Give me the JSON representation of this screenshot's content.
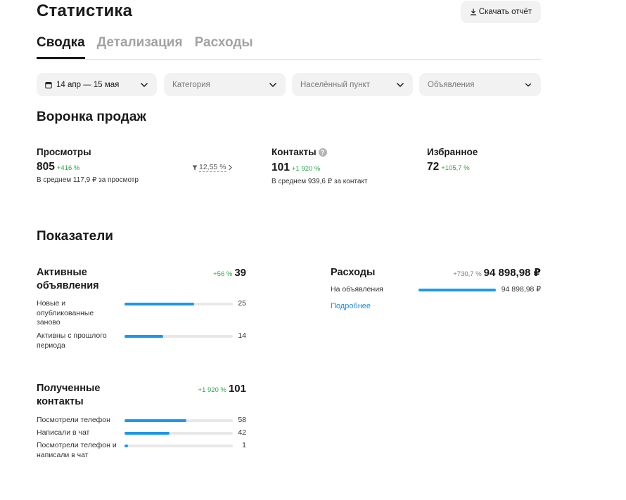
{
  "header": {
    "title": "Статистика",
    "download_label": "Скачать отчёт"
  },
  "tabs": [
    {
      "label": "Сводка",
      "active": true
    },
    {
      "label": "Детализация",
      "active": false
    },
    {
      "label": "Расходы",
      "active": false
    }
  ],
  "filters": {
    "date": "14 апр — 15 мая",
    "category": "Категория",
    "location": "Населённый пункт",
    "ads": "Объявления"
  },
  "funnel": {
    "title": "Воронка продаж",
    "views": {
      "label": "Просмотры",
      "value": "805",
      "delta": "+416 %",
      "sub": "В среднем 117,9 ₽ за просмотр"
    },
    "conversion": "12,55 %",
    "contacts": {
      "label": "Контакты",
      "value": "101",
      "delta": "+1 920 %",
      "sub": "В среднем 939,6 ₽ за контакт"
    },
    "favorites": {
      "label": "Избранное",
      "value": "72",
      "delta": "+105,7 %"
    }
  },
  "indicators": {
    "title": "Показатели",
    "active_ads": {
      "title": "Активные объявления",
      "delta": "+56 %",
      "total": "39",
      "rows": [
        {
          "label": "Новые и опубликованные заново",
          "value": "25",
          "fraction": 0.641
        },
        {
          "label": "Активны с прошлого периода",
          "value": "14",
          "fraction": 0.359
        }
      ]
    },
    "contacts": {
      "title": "Полученные контакты",
      "delta": "+1 920 %",
      "total": "101",
      "rows": [
        {
          "label": "Посмотрели телефон",
          "value": "58",
          "fraction": 0.574
        },
        {
          "label": "Написали в чат",
          "value": "42",
          "fraction": 0.416
        },
        {
          "label": "Посмотрели телефон и написали в чат",
          "value": "1",
          "fraction": 0.03
        }
      ]
    },
    "expenses": {
      "title": "Расходы",
      "delta": "+730,7 %",
      "total": "94 898,98 ₽",
      "rows": [
        {
          "label": "На объявления",
          "value": "94 898,98 ₽",
          "fraction": 1.0
        }
      ],
      "more_link": "Подробнее"
    }
  },
  "colors": {
    "accent": "#1d98e8",
    "positive": "#28a745",
    "link": "#1d8be0"
  },
  "icons": {
    "download": "download-icon",
    "calendar": "calendar-icon",
    "chevron": "chevron-down-icon",
    "help": "help-icon",
    "funnel": "filter-icon"
  }
}
